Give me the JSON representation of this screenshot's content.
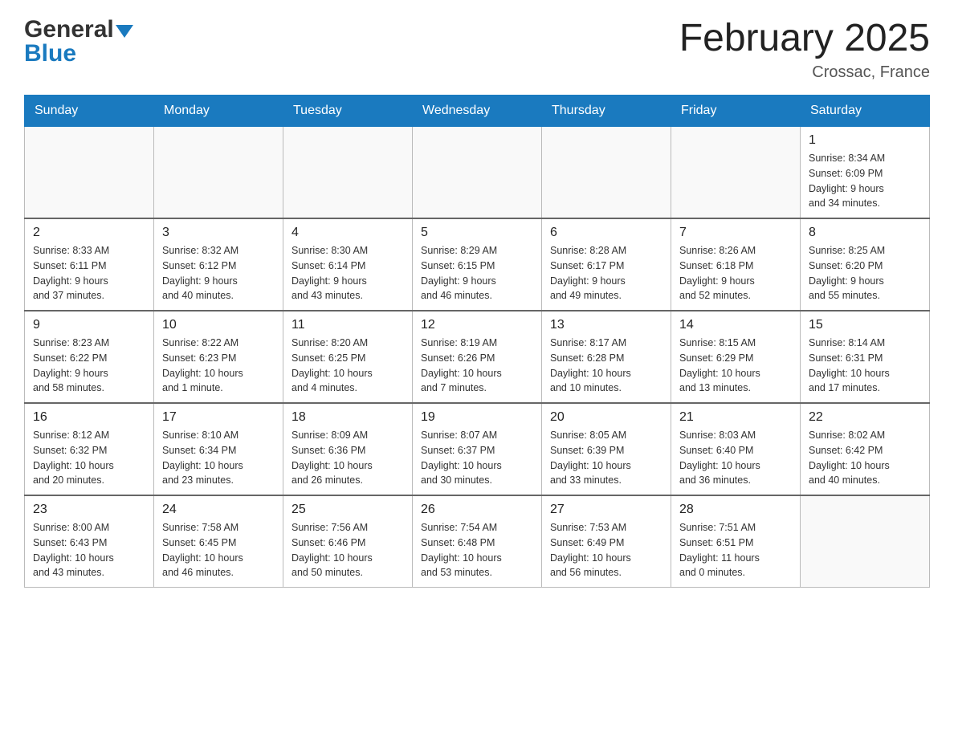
{
  "logo": {
    "line1": "General",
    "line2": "Blue"
  },
  "title": "February 2025",
  "location": "Crossac, France",
  "days_of_week": [
    "Sunday",
    "Monday",
    "Tuesday",
    "Wednesday",
    "Thursday",
    "Friday",
    "Saturday"
  ],
  "weeks": [
    [
      {
        "day": "",
        "info": ""
      },
      {
        "day": "",
        "info": ""
      },
      {
        "day": "",
        "info": ""
      },
      {
        "day": "",
        "info": ""
      },
      {
        "day": "",
        "info": ""
      },
      {
        "day": "",
        "info": ""
      },
      {
        "day": "1",
        "info": "Sunrise: 8:34 AM\nSunset: 6:09 PM\nDaylight: 9 hours\nand 34 minutes."
      }
    ],
    [
      {
        "day": "2",
        "info": "Sunrise: 8:33 AM\nSunset: 6:11 PM\nDaylight: 9 hours\nand 37 minutes."
      },
      {
        "day": "3",
        "info": "Sunrise: 8:32 AM\nSunset: 6:12 PM\nDaylight: 9 hours\nand 40 minutes."
      },
      {
        "day": "4",
        "info": "Sunrise: 8:30 AM\nSunset: 6:14 PM\nDaylight: 9 hours\nand 43 minutes."
      },
      {
        "day": "5",
        "info": "Sunrise: 8:29 AM\nSunset: 6:15 PM\nDaylight: 9 hours\nand 46 minutes."
      },
      {
        "day": "6",
        "info": "Sunrise: 8:28 AM\nSunset: 6:17 PM\nDaylight: 9 hours\nand 49 minutes."
      },
      {
        "day": "7",
        "info": "Sunrise: 8:26 AM\nSunset: 6:18 PM\nDaylight: 9 hours\nand 52 minutes."
      },
      {
        "day": "8",
        "info": "Sunrise: 8:25 AM\nSunset: 6:20 PM\nDaylight: 9 hours\nand 55 minutes."
      }
    ],
    [
      {
        "day": "9",
        "info": "Sunrise: 8:23 AM\nSunset: 6:22 PM\nDaylight: 9 hours\nand 58 minutes."
      },
      {
        "day": "10",
        "info": "Sunrise: 8:22 AM\nSunset: 6:23 PM\nDaylight: 10 hours\nand 1 minute."
      },
      {
        "day": "11",
        "info": "Sunrise: 8:20 AM\nSunset: 6:25 PM\nDaylight: 10 hours\nand 4 minutes."
      },
      {
        "day": "12",
        "info": "Sunrise: 8:19 AM\nSunset: 6:26 PM\nDaylight: 10 hours\nand 7 minutes."
      },
      {
        "day": "13",
        "info": "Sunrise: 8:17 AM\nSunset: 6:28 PM\nDaylight: 10 hours\nand 10 minutes."
      },
      {
        "day": "14",
        "info": "Sunrise: 8:15 AM\nSunset: 6:29 PM\nDaylight: 10 hours\nand 13 minutes."
      },
      {
        "day": "15",
        "info": "Sunrise: 8:14 AM\nSunset: 6:31 PM\nDaylight: 10 hours\nand 17 minutes."
      }
    ],
    [
      {
        "day": "16",
        "info": "Sunrise: 8:12 AM\nSunset: 6:32 PM\nDaylight: 10 hours\nand 20 minutes."
      },
      {
        "day": "17",
        "info": "Sunrise: 8:10 AM\nSunset: 6:34 PM\nDaylight: 10 hours\nand 23 minutes."
      },
      {
        "day": "18",
        "info": "Sunrise: 8:09 AM\nSunset: 6:36 PM\nDaylight: 10 hours\nand 26 minutes."
      },
      {
        "day": "19",
        "info": "Sunrise: 8:07 AM\nSunset: 6:37 PM\nDaylight: 10 hours\nand 30 minutes."
      },
      {
        "day": "20",
        "info": "Sunrise: 8:05 AM\nSunset: 6:39 PM\nDaylight: 10 hours\nand 33 minutes."
      },
      {
        "day": "21",
        "info": "Sunrise: 8:03 AM\nSunset: 6:40 PM\nDaylight: 10 hours\nand 36 minutes."
      },
      {
        "day": "22",
        "info": "Sunrise: 8:02 AM\nSunset: 6:42 PM\nDaylight: 10 hours\nand 40 minutes."
      }
    ],
    [
      {
        "day": "23",
        "info": "Sunrise: 8:00 AM\nSunset: 6:43 PM\nDaylight: 10 hours\nand 43 minutes."
      },
      {
        "day": "24",
        "info": "Sunrise: 7:58 AM\nSunset: 6:45 PM\nDaylight: 10 hours\nand 46 minutes."
      },
      {
        "day": "25",
        "info": "Sunrise: 7:56 AM\nSunset: 6:46 PM\nDaylight: 10 hours\nand 50 minutes."
      },
      {
        "day": "26",
        "info": "Sunrise: 7:54 AM\nSunset: 6:48 PM\nDaylight: 10 hours\nand 53 minutes."
      },
      {
        "day": "27",
        "info": "Sunrise: 7:53 AM\nSunset: 6:49 PM\nDaylight: 10 hours\nand 56 minutes."
      },
      {
        "day": "28",
        "info": "Sunrise: 7:51 AM\nSunset: 6:51 PM\nDaylight: 11 hours\nand 0 minutes."
      },
      {
        "day": "",
        "info": ""
      }
    ]
  ]
}
